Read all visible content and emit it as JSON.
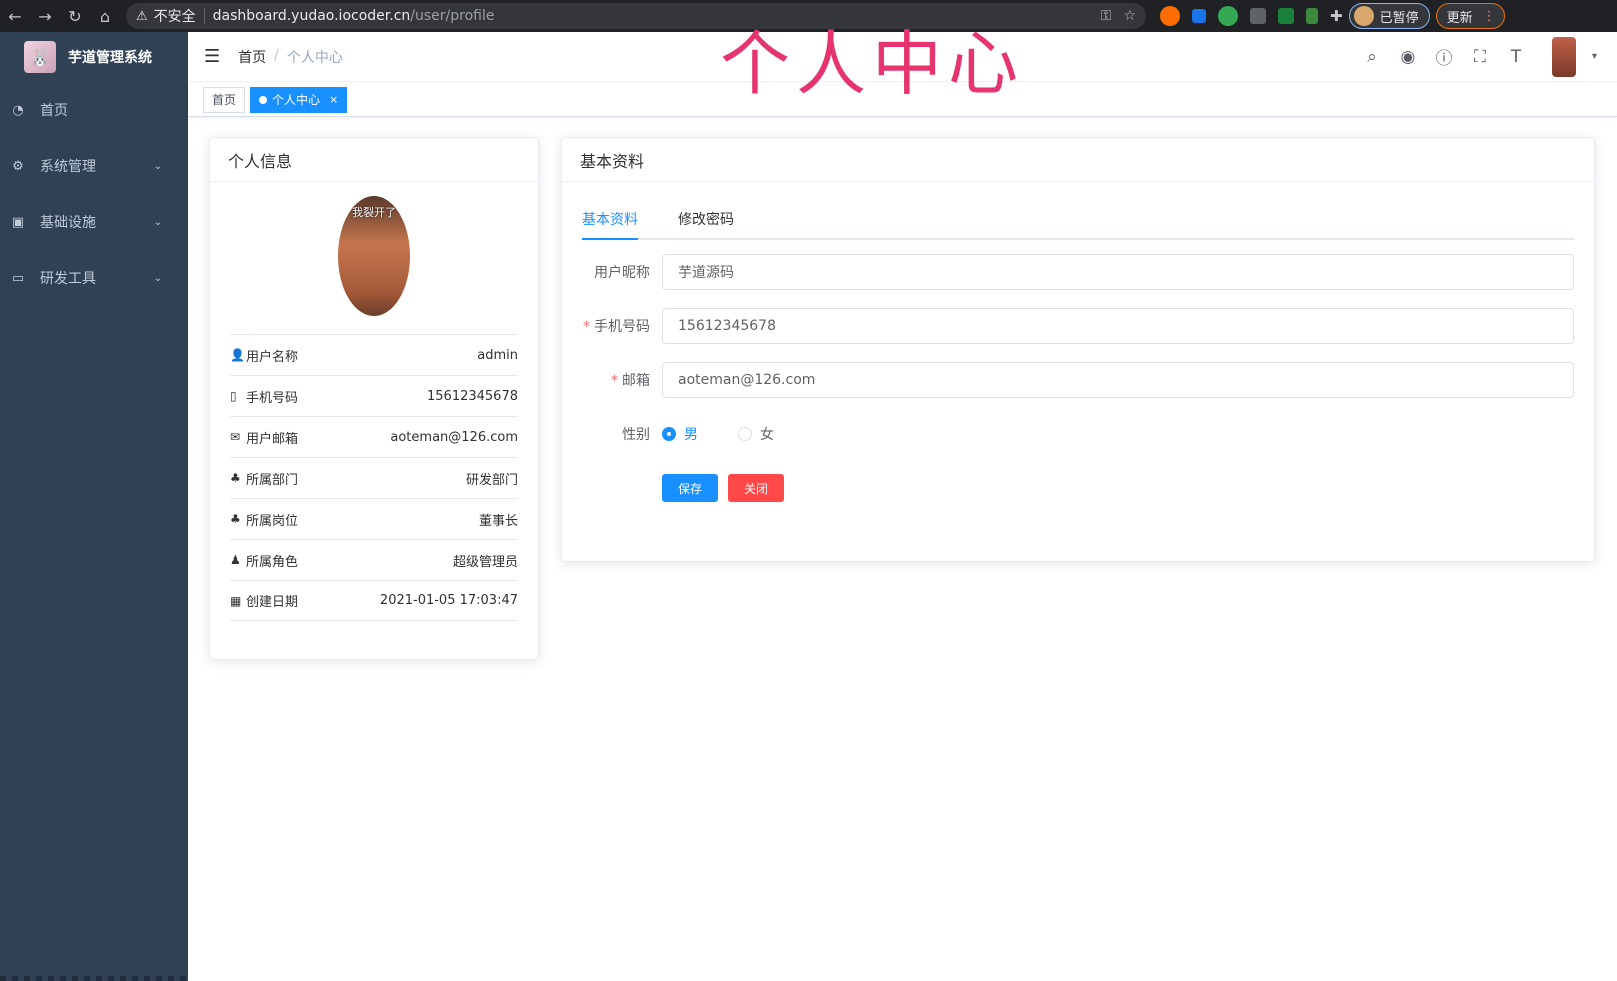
{
  "browser": {
    "insecure_label": "不安全",
    "url_host": "dashboard.yudao.iocoder.cn",
    "url_path": "/user/profile",
    "paused_label": "已暂停",
    "update_label": "更新"
  },
  "sidebar": {
    "brand_title": "芋道管理系统",
    "items": [
      {
        "label": "首页",
        "icon": "dashboard-icon"
      },
      {
        "label": "系统管理",
        "icon": "gear-icon"
      },
      {
        "label": "基础设施",
        "icon": "monitor-icon"
      },
      {
        "label": "研发工具",
        "icon": "toolbox-icon"
      }
    ]
  },
  "header": {
    "breadcrumb": [
      "首页",
      "个人中心"
    ],
    "overlay_title": "个人中心"
  },
  "tags": [
    {
      "label": "首页",
      "active": false
    },
    {
      "label": "个人中心",
      "active": true
    }
  ],
  "profile": {
    "title": "个人信息",
    "avatar_caption": "我裂开了",
    "rows": [
      {
        "label": "用户名称",
        "value": "admin",
        "icon": "user-icon"
      },
      {
        "label": "手机号码",
        "value": "15612345678",
        "icon": "phone-icon"
      },
      {
        "label": "用户邮箱",
        "value": "aoteman@126.com",
        "icon": "mail-icon"
      },
      {
        "label": "所属部门",
        "value": "研发部门",
        "icon": "tree-icon"
      },
      {
        "label": "所属岗位",
        "value": "董事长",
        "icon": "peoples-icon"
      },
      {
        "label": "所属角色",
        "value": "超级管理员",
        "icon": "role-icon"
      },
      {
        "label": "创建日期",
        "value": "2021-01-05 17:03:47",
        "icon": "calendar-icon"
      }
    ]
  },
  "basic": {
    "title": "基本资料",
    "tabs": [
      {
        "label": "基本资料",
        "active": true
      },
      {
        "label": "修改密码",
        "active": false
      }
    ],
    "fields": {
      "nickname": {
        "label": "用户昵称",
        "value": "芋道源码",
        "required": false
      },
      "mobile": {
        "label": "手机号码",
        "value": "15612345678",
        "required": true
      },
      "email": {
        "label": "邮箱",
        "value": "aoteman@126.com",
        "required": true
      }
    },
    "gender": {
      "label": "性别",
      "options": [
        "男",
        "女"
      ],
      "selected": "男"
    },
    "save_label": "保存",
    "close_label": "关闭"
  },
  "colors": {
    "sidebar_bg": "#304156",
    "primary": "#1890ff",
    "danger": "#ff4949",
    "overlay_title": "#e6346e"
  }
}
